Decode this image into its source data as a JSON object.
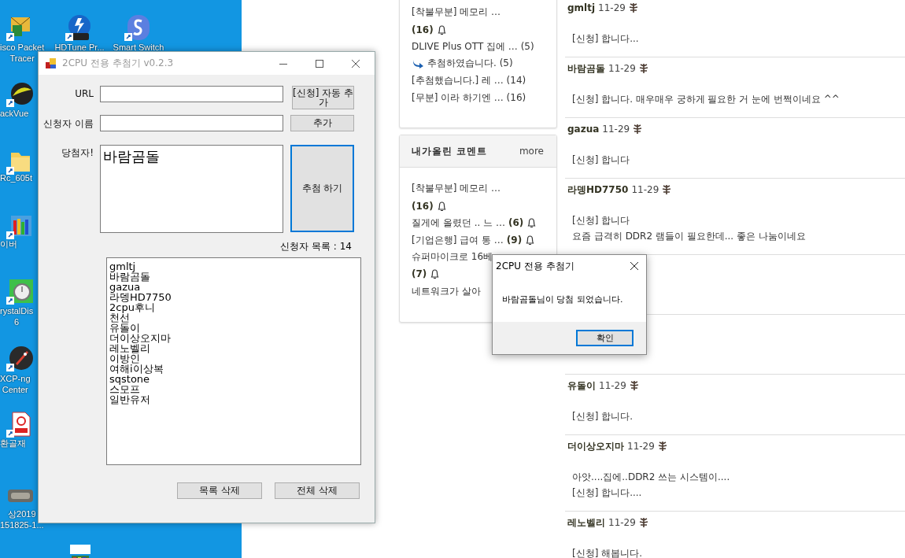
{
  "desktop": {
    "icons": [
      {
        "kind": "packet-tracer",
        "label": "isco Packet\nTracer"
      },
      {
        "kind": "zip",
        "label": "HDTune Pr..."
      },
      {
        "kind": "smart-switch",
        "label": "Smart Switch"
      },
      {
        "kind": "ackvue",
        "label": "ackVue"
      },
      {
        "kind": "folder",
        "label": "Rc_605t"
      },
      {
        "kind": "chart-app",
        "label": "이버"
      },
      {
        "kind": "stopwatch",
        "label": "rystalDis\n6"
      },
      {
        "kind": "rocket",
        "label": "XCP-ng\nCenter"
      },
      {
        "kind": "pdf",
        "label": "환골재"
      },
      {
        "kind": "photo",
        "label": "상2019\n151825-1..."
      },
      {
        "kind": "kgl"
      }
    ]
  },
  "browser_page": {
    "recent_posts": {
      "items": [
        {
          "kind": "post",
          "text": "[착불무분] 메모리 …"
        },
        {
          "kind": "post",
          "count": "(16)",
          "bell": true
        },
        {
          "kind": "post",
          "text": "DLIVE Plus OTT 집에 … (5)"
        },
        {
          "kind": "reply",
          "text": "추첨하였습니다. (5)"
        },
        {
          "kind": "post",
          "text": "[추첨했습니다.] 레 … (14)"
        },
        {
          "kind": "post",
          "text": "[무분] 이라 하기엔  … (16)"
        }
      ]
    },
    "my_comments": {
      "title": "내가올린 코멘트",
      "more": "more",
      "items": [
        {
          "kind": "post",
          "text": "[착불무분] 메모리 …"
        },
        {
          "kind": "post",
          "count": "(16)",
          "bell": true
        },
        {
          "kind": "post",
          "text": "질게에 올렸던 .. 느 …",
          "count": "(6)",
          "bell": true
        },
        {
          "kind": "post",
          "text": "[기업은행] 급여 통 …",
          "count": "(9)",
          "bell": true
        },
        {
          "kind": "post",
          "text": "슈퍼마이크로 16베"
        },
        {
          "kind": "post",
          "count": "(7)",
          "bell": true
        },
        {
          "kind": "post",
          "text": "네트워크가 살아"
        }
      ]
    },
    "comments_above": [
      {
        "author": "gmltj",
        "date": "11-29",
        "body": [
          "[신청] 합니다..."
        ]
      },
      {
        "author": "바람곰돌",
        "date": "11-29",
        "body": [
          "[신청] 합니다. 매우매우 궁하게 필요한 거 눈에 번쩍이네요 ^^"
        ]
      },
      {
        "author": "gazua",
        "date": "11-29",
        "body": [
          "[신청] 합니다"
        ]
      },
      {
        "author": "라뎅HD7750",
        "date": "11-29",
        "body": [
          "[신청] 합니다",
          "요즘 급격히 DDR2 램들이 필요한데... 좋은 나눔이네요"
        ]
      }
    ],
    "comments_below": [
      {
        "author": "유돌이",
        "date": "11-29",
        "body": [
          "[신청] 합니다."
        ]
      },
      {
        "author": "더이상오지마",
        "date": "11-29",
        "body": [
          "아앗....집에..DDR2 쓰는 시스템이....",
          "[신청] 합니다...."
        ]
      },
      {
        "author": "레노벨리",
        "date": "11-29",
        "body": [
          "[신청] 해봅니다."
        ]
      }
    ]
  },
  "app_window": {
    "title": "2CPU 전용 추첨기 v0.2.3",
    "url_label": "URL",
    "auto_add_button": "[신청] 자동 추가",
    "name_label": "신청자 이름",
    "add_button": "추가",
    "winner_label": "당첨자!",
    "winner": "바람곰돌",
    "draw_button": "추첨 하기",
    "list_count": "신청자 목록 : 14",
    "applicants": [
      "gmltj",
      "바람곰돌",
      "gazua",
      "라뎅HD7750",
      "2cpu후니",
      "천선",
      "유돌이",
      "더이상오지마",
      "레노벨리",
      "이방인",
      "여해i이상복",
      "sqstone",
      "스모프",
      "일반유저"
    ],
    "delete_selected_button": "목록 삭제",
    "delete_all_button": "전체 삭제"
  },
  "dialog": {
    "title": "2CPU 전용 추첨기",
    "message": "바람곰돌님이 당첨 되었습니다.",
    "ok_button": "확인"
  }
}
